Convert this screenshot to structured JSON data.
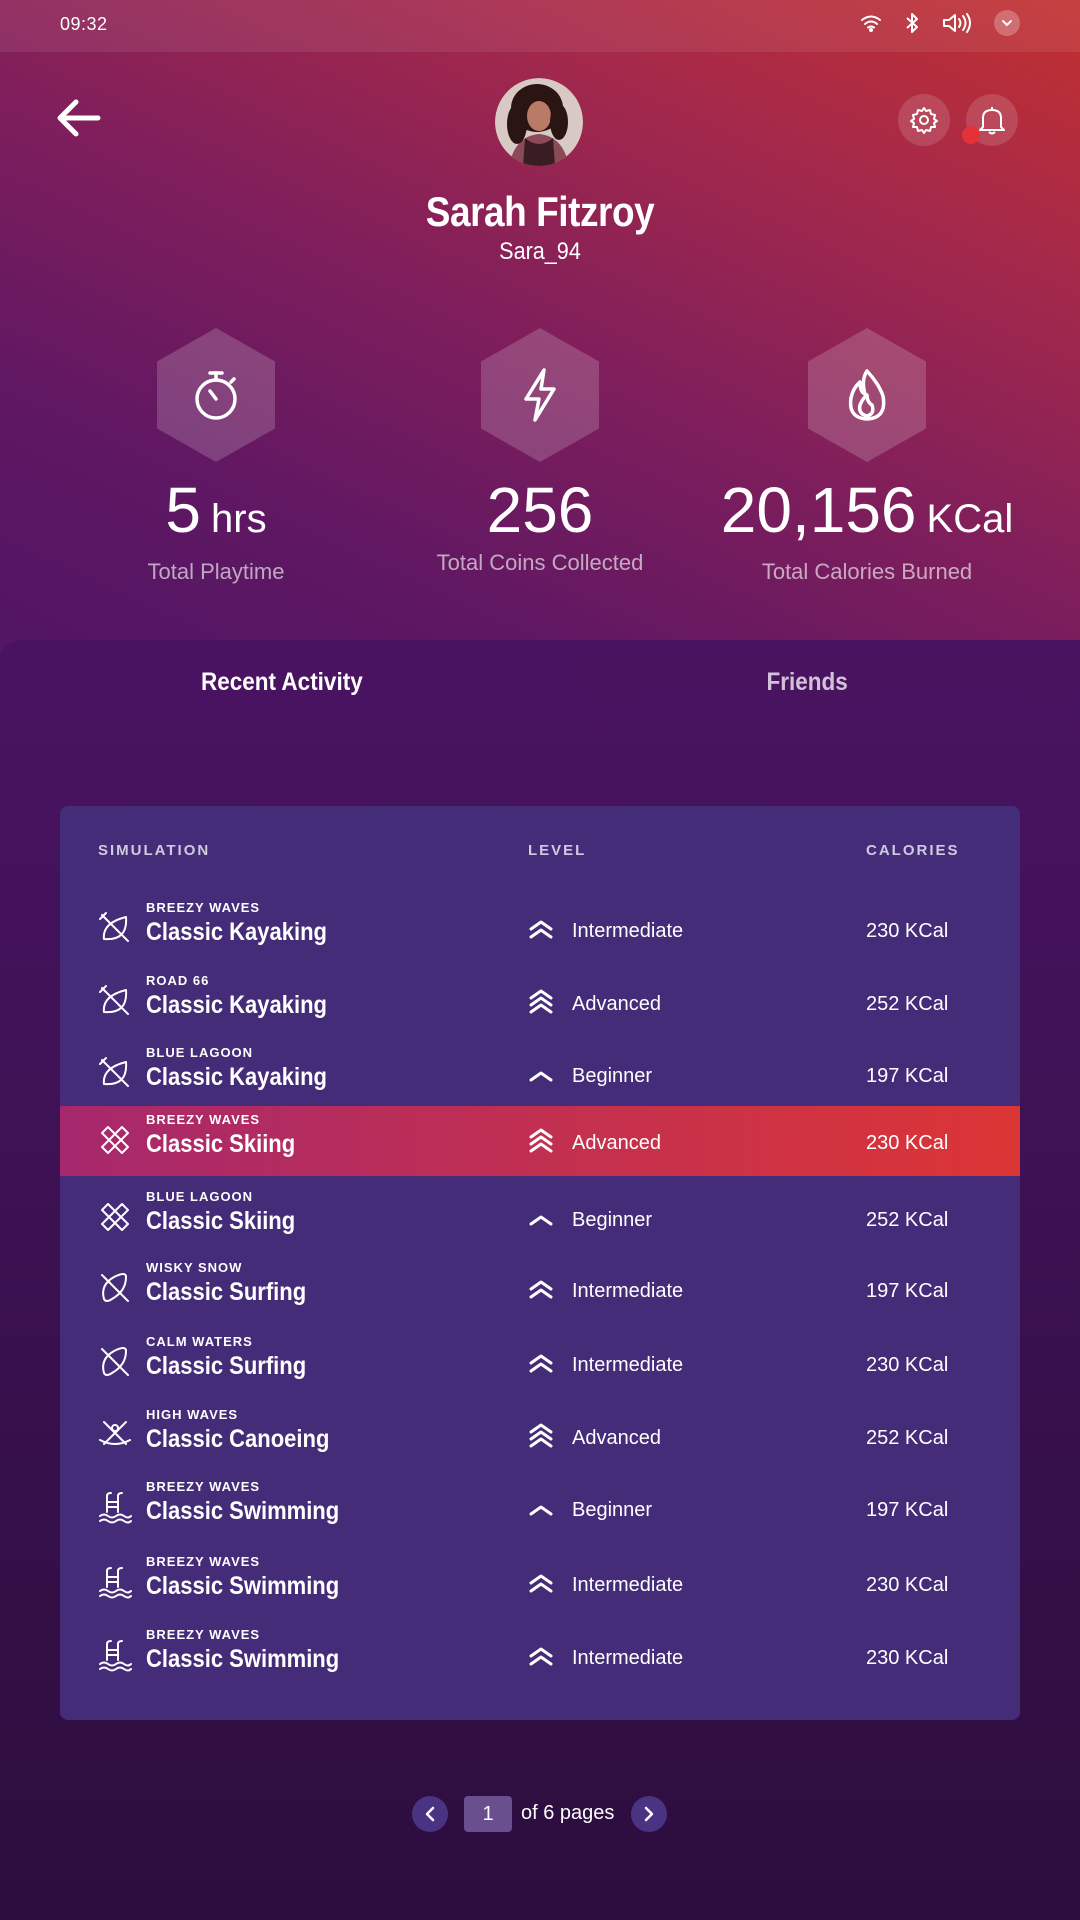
{
  "status": {
    "time": "09:32"
  },
  "profile": {
    "name": "Sarah Fitzroy",
    "username": "Sara_94"
  },
  "stats": [
    {
      "icon": "stopwatch-icon",
      "value": "5",
      "unit": "hrs",
      "label": "Total Playtime"
    },
    {
      "icon": "lightning-icon",
      "value": "256",
      "unit": "",
      "label": "Total Coins Collected"
    },
    {
      "icon": "flame-icon",
      "value": "20,156",
      "unit": "KCal",
      "label": "Total Calories Burned"
    }
  ],
  "tabs": {
    "recent": "Recent Activity",
    "friends": "Friends"
  },
  "table": {
    "headers": {
      "simulation": "SIMULATION",
      "level": "LEVEL",
      "calories": "CALORIES"
    },
    "rows": [
      {
        "location": "BREEZY WAVES",
        "title": "Classic Kayaking",
        "level": "Intermediate",
        "calories": "230 KCal",
        "icon": "kayak-icon"
      },
      {
        "location": "ROAD 66",
        "title": "Classic Kayaking",
        "level": "Advanced",
        "calories": "252 KCal",
        "icon": "kayak-icon"
      },
      {
        "location": "BLUE LAGOON",
        "title": "Classic Kayaking",
        "level": "Beginner",
        "calories": "197 KCal",
        "icon": "kayak-icon"
      },
      {
        "location": "BREEZY WAVES",
        "title": "Classic Skiing",
        "level": "Advanced",
        "calories": "230 KCal",
        "icon": "ski-icon",
        "highlight": true
      },
      {
        "location": "BLUE LAGOON",
        "title": "Classic Skiing",
        "level": "Beginner",
        "calories": "252 KCal",
        "icon": "ski-icon"
      },
      {
        "location": "WISKY SNOW",
        "title": "Classic Surfing",
        "level": "Intermediate",
        "calories": "197 KCal",
        "icon": "surfboard-icon"
      },
      {
        "location": "CALM WATERS",
        "title": "Classic Surfing",
        "level": "Intermediate",
        "calories": "230 KCal",
        "icon": "surfboard-icon"
      },
      {
        "location": "HIGH WAVES",
        "title": "Classic Canoeing",
        "level": "Advanced",
        "calories": "252 KCal",
        "icon": "canoe-icon"
      },
      {
        "location": "BREEZY WAVES",
        "title": "Classic Swimming",
        "level": "Beginner",
        "calories": "197 KCal",
        "icon": "pool-icon"
      },
      {
        "location": "BREEZY WAVES",
        "title": "Classic Swimming",
        "level": "Intermediate",
        "calories": "230 KCal",
        "icon": "pool-icon"
      },
      {
        "location": "BREEZY WAVES",
        "title": "Classic Swimming",
        "level": "Intermediate",
        "calories": "230 KCal",
        "icon": "pool-icon"
      }
    ]
  },
  "pager": {
    "current": "1",
    "text": "of 6 pages"
  }
}
